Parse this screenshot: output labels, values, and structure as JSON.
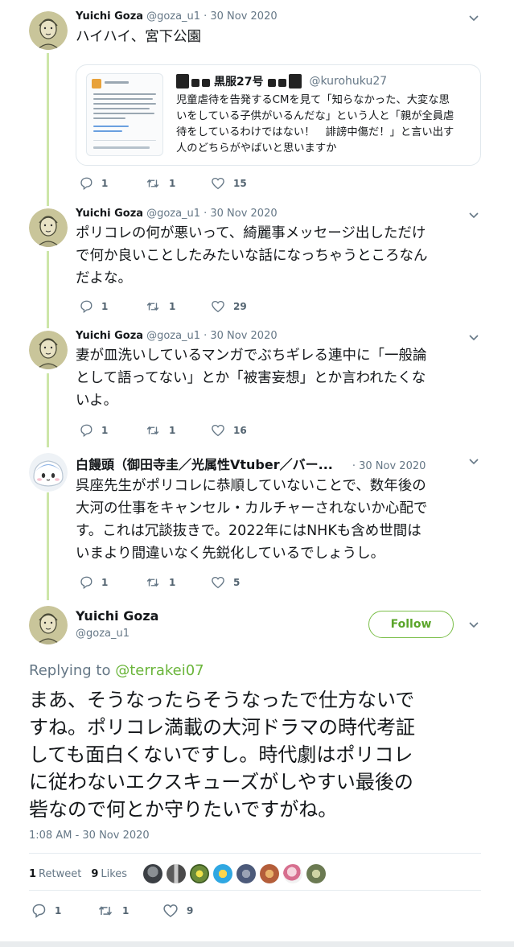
{
  "tweets": [
    {
      "name": "Yuichi Goza",
      "handle": "@goza_u1",
      "date": "· 30 Nov 2020",
      "text": "ハイハイ、宮下公園",
      "replies": "1",
      "retweets": "1",
      "likes": "15"
    },
    {
      "name": "Yuichi Goza",
      "handle": "@goza_u1",
      "date": "· 30 Nov 2020",
      "text": "ポリコレの何が悪いって、綺麗事メッセージ出しただけ\nで何か良いことしたみたいな話になっちゃうところなん\nだよな。",
      "replies": "1",
      "retweets": "1",
      "likes": "29"
    },
    {
      "name": "Yuichi Goza",
      "handle": "@goza_u1",
      "date": "· 30 Nov 2020",
      "text": "妻が皿洗いしているマンガでぶちギレる連中に「一般論\nとして語ってない」とか「被害妄想」とか言われたくな\nいよ。",
      "replies": "1",
      "retweets": "1",
      "likes": "16"
    },
    {
      "name": "白饅頭（御田寺圭／光属性Vtuber／バー...",
      "handle": "",
      "date": "· 30 Nov 2020",
      "text": "呉座先生がポリコレに恭順していないことで、数年後の\n大河の仕事をキャンセル・カルチャーされないか心配で\nす。これは冗談抜きで。2022年にはNHKも含め世間は\nいまより間違いなく先鋭化しているでしょうし。",
      "replies": "1",
      "retweets": "1",
      "likes": "5"
    }
  ],
  "quote": {
    "name": "黒服27号",
    "handle": "@kurohuku27",
    "text": "児童虐待を告発するCMを見て「知らなかった、大変な思\nいをしている子供がいるんだな」という人と「親が全員虐\n待をしているわけではない！　誹謗中傷だ！」と言い出す\n人のどちらがやばいと思いますか"
  },
  "main": {
    "name": "Yuichi Goza",
    "handle": "@goza_u1",
    "follow_label": "Follow",
    "replying_prefix": "Replying to ",
    "replying_to": "@terrakei07",
    "text": "まあ、そうなったらそうなったで仕方ないで\nすね。ポリコレ満載の大河ドラマの時代考証\nしても面白くないですし。時代劇はポリコレ\nに従わないエクスキューズがしやすい最後の\n砦なので何とか守りたいですがね。",
    "timestamp": "1:08 AM - 30 Nov 2020",
    "retweet_count": "1",
    "retweet_label": "Retweet",
    "like_count": "9",
    "like_label": "Likes",
    "replies": "1",
    "retweets": "1",
    "likes": "9"
  },
  "colors": {
    "thread_line": "#cde6a9",
    "accent_green": "#6ab53a",
    "secondary_text": "#657786"
  },
  "icons": [
    "reply-icon",
    "retweet-icon",
    "heart-icon",
    "chevron-down-icon"
  ]
}
